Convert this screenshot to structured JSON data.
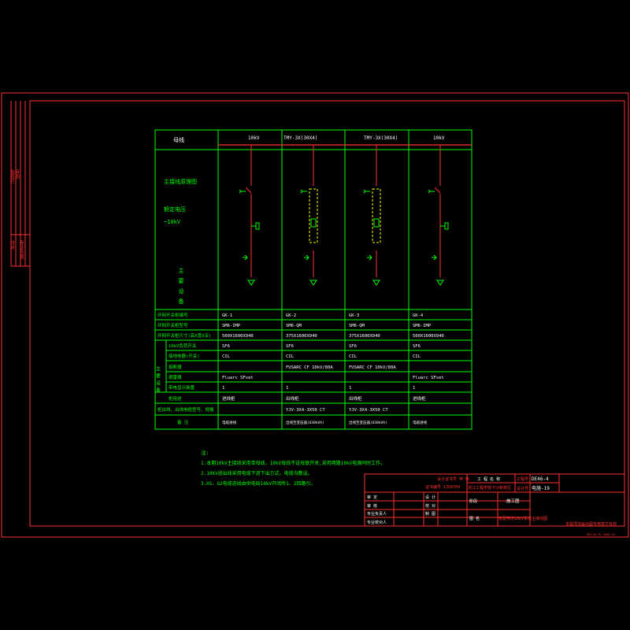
{
  "header": {
    "busbar": "母线",
    "bus_labels": [
      "10kV",
      "TMY-3X(30X4)",
      "TMY-3X(30X4)",
      "10kV"
    ]
  },
  "left_labels": {
    "diagram_title": "主接线原理图",
    "rated_voltage_label": "额定电压",
    "rated_voltage_value": "~10kV",
    "main_equipment": "主要设备"
  },
  "rows": [
    {
      "label": "环网开关柜编号",
      "cells": [
        "GK-1",
        "GK-2",
        "GK-3",
        "GK-4"
      ]
    },
    {
      "label": "环网开关柜型号",
      "cells": [
        "SM6-IMP",
        "SM6-QM",
        "SM6-QM",
        "SM6-IMP"
      ]
    },
    {
      "label": "环网开关柜尺寸(高X宽X深)",
      "cells": [
        "500X1600X940",
        "375X1600X940",
        "375X1600X940",
        "500X1600X940"
      ]
    },
    {
      "label": "10kV负荷开关",
      "cells": [
        "SF6",
        "SF6",
        "SF6",
        "SF6"
      ]
    },
    {
      "label": "接地电器(开关)",
      "cells": [
        "CIL",
        "CIL",
        "CIL",
        "CIL"
      ]
    },
    {
      "label": "熔断器",
      "cells": [
        "",
        "FUSARC CF  10kV/80A",
        "FUSARC CF  10kV/80A",
        ""
      ]
    },
    {
      "label": "避雷器",
      "cells": [
        "Fluarc SFset",
        "",
        "",
        "Fluarc SFset"
      ]
    },
    {
      "label": "带电显示装置",
      "cells": [
        "1",
        "1",
        "1",
        "1"
      ]
    },
    {
      "label": "柜用途",
      "cells": [
        "进线柜",
        "出线柜",
        "出线柜",
        "进线柜"
      ]
    },
    {
      "label": "柜出线、出线电缆型号、规格",
      "cells": [
        "",
        "YJV-3X4-3X50 CT",
        "YJV-3X4-3X50 CT",
        ""
      ]
    },
    {
      "label": "备  注",
      "cells": [
        "电缆进线",
        "出线至变压器(630kVA)",
        "出线至变压器(630kVA)",
        "电缆进线"
      ]
    }
  ],
  "main_equipment_side": "主要设备",
  "notes": {
    "title": "注:",
    "items": [
      "1.本期10kV主接线采用单母线，10kV母线不设母联开关,采用两路10kV电源同时工作。",
      "2.10kV进出线采用电缆下进下出方式，电缆沟敷设。",
      "3.H1、G2电缆进线由供电局10kV开闭所1、2回路引。"
    ]
  },
  "title_block": {
    "company": "工 程 名 称",
    "drawing_no_label": "工程号",
    "drawing_no": "DE46-4",
    "design_no_label": "设计号",
    "design_no": "电施-19",
    "project_name": "浙江工程学院下沙新校区",
    "cert1": "设计证书号 甲 级",
    "cert2": "证书编号 1350700",
    "roles": [
      "审 定",
      "审 核",
      "专业负责人",
      "专业校对人"
    ],
    "roles2": [
      "设 计",
      "校 对",
      "制 图"
    ],
    "stage_label": "阶段",
    "stage": "施工图",
    "fig_label": "图 名",
    "fig_name": "变配电所10kV系统主接线图",
    "right_note": "本图须加盖出图专用章方有效",
    "bottom_tiny": "GR5-BS-PL-2000  A3"
  },
  "left_strip": [
    "会签栏",
    "审图",
    "校对",
    "专业负责"
  ]
}
